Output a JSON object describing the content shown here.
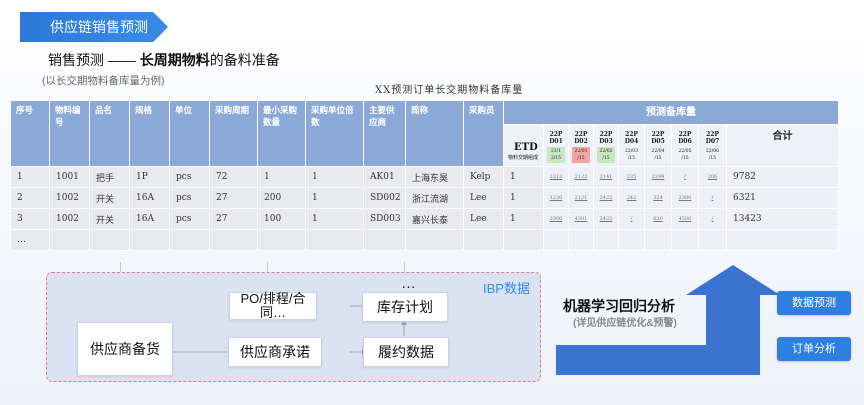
{
  "banner": {
    "title": "供应链销售预测"
  },
  "subtitle": {
    "prefix": "销售预测 —— ",
    "bold": "长周期物料",
    "suffix": "的备料准备"
  },
  "note": "(以长交期物料备库量为例)",
  "table": {
    "title": "XX预测订单长交期物料备库量",
    "headers": [
      "序号",
      "物料编号",
      "品名",
      "规格",
      "单位",
      "采购周期",
      "最小采购数量",
      "采购单位倍数",
      "主要供应商",
      "简称",
      "采购员"
    ],
    "forecast_header": "预测备库量",
    "etd_label": "ETD",
    "etd_sub": "物料交期组成",
    "total_header": "合计",
    "forecast_cols": [
      {
        "code": "22P D01",
        "date": "21/1 2/15",
        "tint": "green"
      },
      {
        "code": "22P D02",
        "date": "22/01 /15",
        "tint": "pink"
      },
      {
        "code": "22P D03",
        "date": "22/02 /15",
        "tint": "green"
      },
      {
        "code": "22P D04",
        "date": "22/03 /15",
        "tint": ""
      },
      {
        "code": "22P D05",
        "date": "22/04 /15",
        "tint": ""
      },
      {
        "code": "22P D06",
        "date": "22/05 /15",
        "tint": ""
      },
      {
        "code": "22P D07",
        "date": "22/06 /15",
        "tint": ""
      }
    ],
    "rows": [
      {
        "cells": [
          "1",
          "1001",
          "把手",
          "1P",
          "pcs",
          "72",
          "1",
          "1",
          "AK01",
          "上海东昊",
          "Kelp"
        ],
        "etd": "1",
        "forecast": [
          {
            "v": "2313",
            "c": ""
          },
          {
            "v": "2123",
            "c": ""
          },
          {
            "v": "2141",
            "c": "grn"
          },
          {
            "v": "235",
            "c": ""
          },
          {
            "v": "2399",
            "c": ""
          },
          {
            "v": "/",
            "c": ""
          },
          {
            "v": "206",
            "c": ""
          }
        ],
        "total": "9782"
      },
      {
        "cells": [
          "2",
          "1002",
          "开关",
          "16A",
          "pcs",
          "27",
          "200",
          "1",
          "SD002",
          "浙江流湖",
          "Lee"
        ],
        "etd": "1",
        "forecast": [
          {
            "v": "1230",
            "c": ""
          },
          {
            "v": "2121",
            "c": "red"
          },
          {
            "v": "2422",
            "c": ""
          },
          {
            "v": "242",
            "c": "red"
          },
          {
            "v": "324",
            "c": ""
          },
          {
            "v": "2300",
            "c": ""
          },
          {
            "v": "/",
            "c": ""
          }
        ],
        "total": "6321"
      },
      {
        "cells": [
          "3",
          "1002",
          "开关",
          "16A",
          "pcs",
          "27",
          "100",
          "1",
          "SD003",
          "嘉兴长泰",
          "Lee"
        ],
        "etd": "1",
        "forecast": [
          {
            "v": "2300",
            "c": ""
          },
          {
            "v": "4301",
            "c": ""
          },
          {
            "v": "2422",
            "c": ""
          },
          {
            "v": "/",
            "c": ""
          },
          {
            "v": "620",
            "c": ""
          },
          {
            "v": "4500",
            "c": ""
          },
          {
            "v": "/",
            "c": ""
          }
        ],
        "total": "13423"
      },
      {
        "cells": [
          "…",
          "",
          "",
          "",
          "",
          "",
          "",
          "",
          "",
          "",
          ""
        ],
        "etd": "",
        "forecast": [
          {
            "v": "",
            "c": ""
          },
          {
            "v": "",
            "c": ""
          },
          {
            "v": "",
            "c": ""
          },
          {
            "v": "",
            "c": ""
          },
          {
            "v": "",
            "c": ""
          },
          {
            "v": "",
            "c": ""
          },
          {
            "v": "",
            "c": ""
          }
        ],
        "total": ""
      }
    ]
  },
  "ibp": {
    "label": "IBP数据",
    "ellipsis": "…",
    "supplier_stock": "供应商备货",
    "po": "PO/排程/合同…",
    "inventory_plan": "库存计划",
    "supplier_commit": "供应商承诺",
    "fulfillment": "履约数据"
  },
  "ml": {
    "title": "机器学习回归分析",
    "sub": "(详见供应链优化&预警)"
  },
  "buttons": {
    "forecast": "数据预测",
    "order": "订单分析"
  },
  "colors": {
    "accent": "#2f7fe0",
    "table_header": "#8aa9d6",
    "ibp_bg": "#dbe3f2",
    "arrow": "#3b73d1"
  }
}
